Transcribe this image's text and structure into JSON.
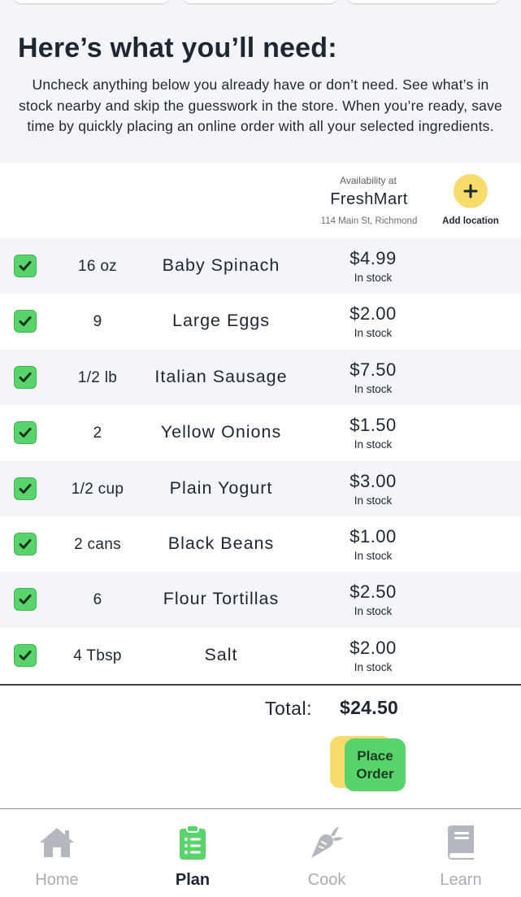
{
  "intro": {
    "title": "Here’s what you’ll need:",
    "description": "Uncheck anything below you already have or don’t need.  See what’s in stock nearby and skip the guesswork in the store.  When you’re ready, save time by quickly placing an online order with all your selected ingredients."
  },
  "store": {
    "availability_label": "Availability at",
    "name": "FreshMart",
    "address": "114 Main St, Richmond",
    "add_location_label": "Add location",
    "add_icon": "plus-icon"
  },
  "items": [
    {
      "checked": true,
      "qty": "16 oz",
      "name": "Baby Spinach",
      "price": "$4.99",
      "stock": "In stock"
    },
    {
      "checked": true,
      "qty": "9",
      "name": "Large Eggs",
      "price": "$2.00",
      "stock": "In stock"
    },
    {
      "checked": true,
      "qty": "1/2 lb",
      "name": "Italian Sausage",
      "price": "$7.50",
      "stock": "In stock"
    },
    {
      "checked": true,
      "qty": "2",
      "name": "Yellow Onions",
      "price": "$1.50",
      "stock": "In stock"
    },
    {
      "checked": true,
      "qty": "1/2 cup",
      "name": "Plain Yogurt",
      "price": "$3.00",
      "stock": "In stock"
    },
    {
      "checked": true,
      "qty": "2 cans",
      "name": "Black Beans",
      "price": "$1.00",
      "stock": "In stock"
    },
    {
      "checked": true,
      "qty": "6",
      "name": "Flour Tortillas",
      "price": "$2.50",
      "stock": "In stock"
    },
    {
      "checked": true,
      "qty": "4 Tbsp",
      "name": "Salt",
      "price": "$2.00",
      "stock": "In stock"
    }
  ],
  "summary": {
    "total_label": "Total:",
    "total_value": "$24.50",
    "place_order_line1": "Place",
    "place_order_line2": "Order"
  },
  "nav": {
    "items": [
      {
        "label": "Home",
        "icon": "home-icon",
        "active": false
      },
      {
        "label": "Plan",
        "icon": "clipboard-list-icon",
        "active": true
      },
      {
        "label": "Cook",
        "icon": "carrot-icon",
        "active": false
      },
      {
        "label": "Learn",
        "icon": "book-icon",
        "active": false
      }
    ]
  },
  "colors": {
    "accent_green": "#58d46a",
    "accent_yellow": "#f8dc6b",
    "text_dark": "#1d2733",
    "inactive_gray": "#a9aeb4",
    "row_alt_bg": "#f3f5f8"
  }
}
